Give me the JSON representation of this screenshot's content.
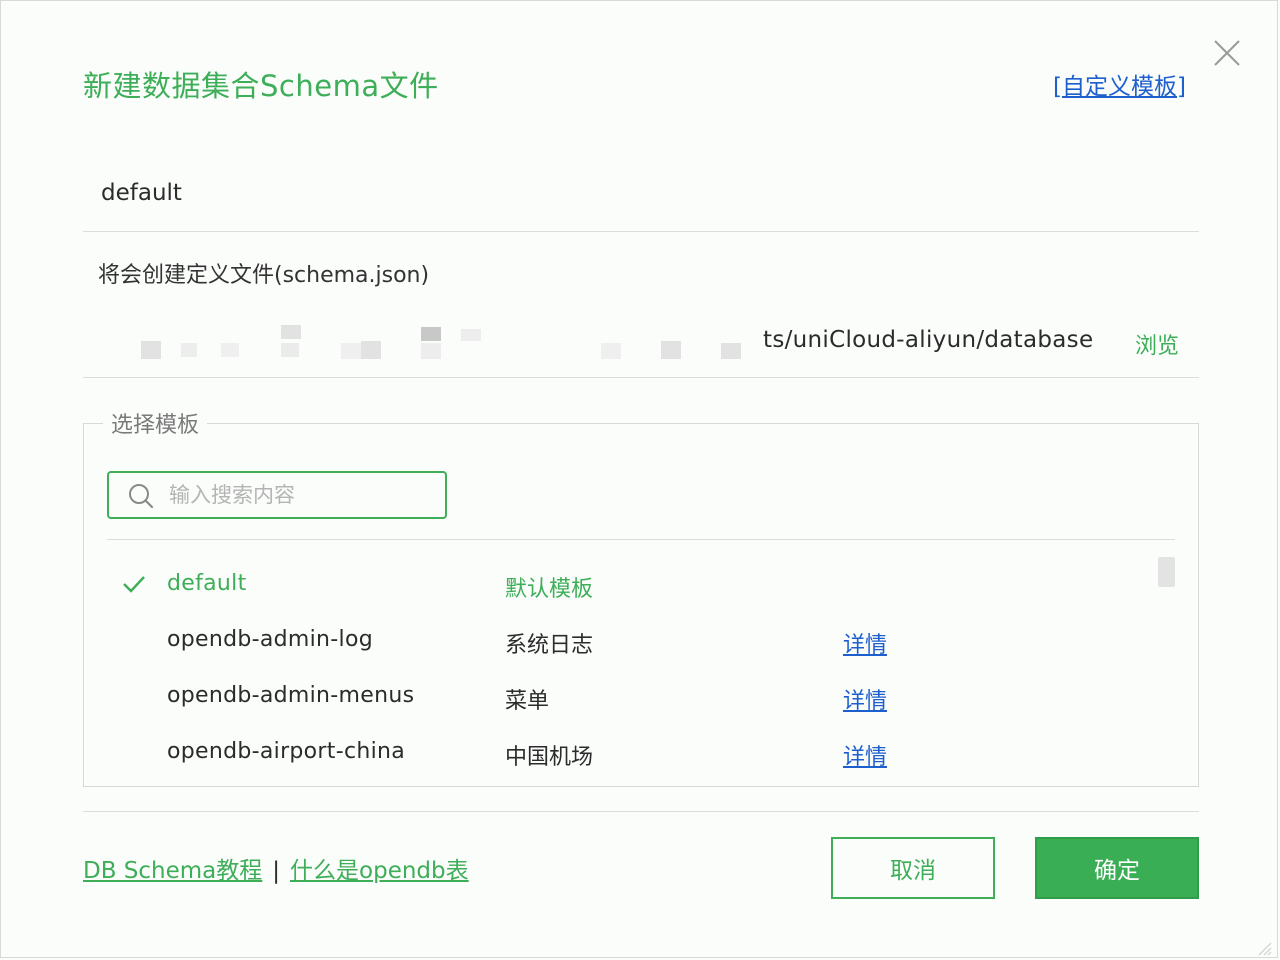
{
  "dialog": {
    "title": "新建数据集合Schema文件",
    "custom_template_link": "[自定义模板]"
  },
  "name_field": {
    "value": "default"
  },
  "hint": "将会创建定义文件(schema.json)",
  "path": {
    "visible_text": "ts/uniCloud-aliyun/database",
    "browse_label": "浏览"
  },
  "template_section": {
    "legend": "选择模板",
    "search_placeholder": "输入搜索内容",
    "items": [
      {
        "name": "default",
        "desc": "默认模板",
        "detail": "",
        "selected": true
      },
      {
        "name": "opendb-admin-log",
        "desc": "系统日志",
        "detail": "详情",
        "selected": false
      },
      {
        "name": "opendb-admin-menus",
        "desc": "菜单",
        "detail": "详情",
        "selected": false
      },
      {
        "name": "opendb-airport-china",
        "desc": "中国机场",
        "detail": "详情",
        "selected": false
      }
    ]
  },
  "footer": {
    "link_tutorial": "DB Schema教程",
    "separator": "|",
    "link_opendb": "什么是opendb表",
    "cancel_label": "取消",
    "ok_label": "确定"
  },
  "colors": {
    "accent_green": "#3eae58",
    "link_blue": "#1d5fcc",
    "primary_button": "#3aae54"
  },
  "icons": [
    "close-icon",
    "search-icon",
    "check-icon",
    "resize-grip-icon"
  ]
}
